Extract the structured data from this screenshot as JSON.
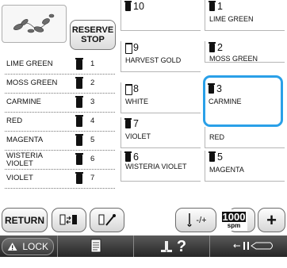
{
  "reserve_button": {
    "line1": "RESERVE",
    "line2": "STOP"
  },
  "order_list": [
    {
      "name": "LIME GREEN",
      "number": "1"
    },
    {
      "name": "MOSS GREEN",
      "number": "2"
    },
    {
      "name": "CARMINE",
      "number": "3"
    },
    {
      "name": "RED",
      "number": "4"
    },
    {
      "name": "MAGENTA",
      "number": "5"
    },
    {
      "name": "WISTERIA VIOLET",
      "number": "6"
    },
    {
      "name": "VIOLET",
      "number": "7"
    }
  ],
  "grid": [
    {
      "number": "10",
      "name": "",
      "spool": "dark"
    },
    {
      "number": "1",
      "name": "LIME GREEN",
      "spool": "dark"
    },
    {
      "number": "9",
      "name": "HARVEST GOLD",
      "spool": "light"
    },
    {
      "number": "2",
      "name": "MOSS GREEN",
      "spool": "dark"
    },
    {
      "number": "8",
      "name": "WHITE",
      "spool": "light"
    },
    {
      "number": "3",
      "name": "CARMINE",
      "spool": "dark"
    },
    {
      "number": "7",
      "name": "VIOLET",
      "spool": "dark"
    },
    {
      "number": "",
      "name": "RED",
      "spool": "dark"
    },
    {
      "number": "6",
      "name": "WISTERIA VIOLET",
      "spool": "dark"
    },
    {
      "number": "5",
      "name": "MAGENTA",
      "spool": "dark"
    }
  ],
  "toolbar": {
    "return_label": "RETURN",
    "plus_minus_label": "-/+",
    "speed_value": "1000",
    "speed_unit": "spm",
    "minus_label": "−",
    "plus_label": "+"
  },
  "footer": {
    "lock_label": "LOCK",
    "help_label": "?"
  },
  "colors": {
    "highlight": "#2aa0e8",
    "footer_bg": "#3c3c3c"
  }
}
